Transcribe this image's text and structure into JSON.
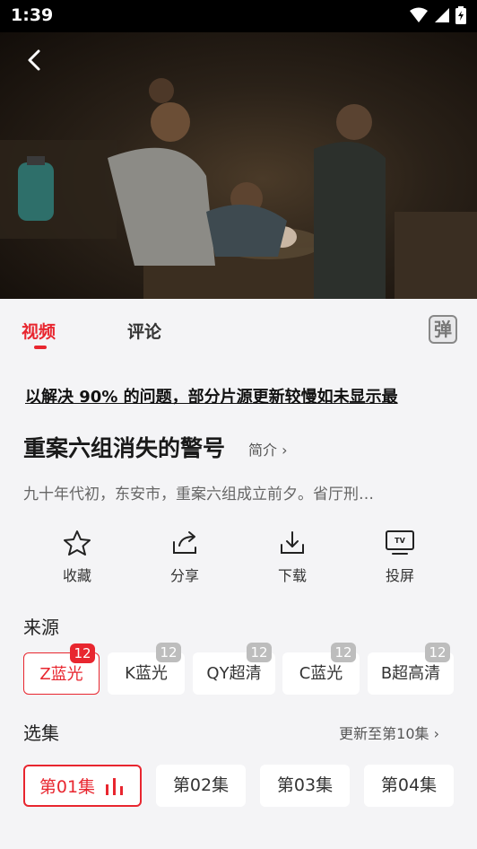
{
  "status_bar": {
    "time": "1:39"
  },
  "tabs": {
    "video": "视频",
    "comment": "评论",
    "danmaku": "弹"
  },
  "notice": "以解决 90% 的问题，部分片源更新较慢如未显示最",
  "show": {
    "title": "重案六组消失的警号",
    "intro_link": "简介 ›",
    "description": "九十年代初，东安市，重案六组成立前夕。省厅刑…"
  },
  "actions": [
    {
      "label": "收藏",
      "icon": "star-icon"
    },
    {
      "label": "分享",
      "icon": "share-icon"
    },
    {
      "label": "下载",
      "icon": "download-icon"
    },
    {
      "label": "投屏",
      "icon": "tv-cast-icon"
    }
  ],
  "sources": {
    "title": "来源",
    "items": [
      {
        "label": "Z蓝光",
        "badge": "12",
        "active": true
      },
      {
        "label": "K蓝光",
        "badge": "12",
        "active": false
      },
      {
        "label": "QY超清",
        "badge": "12",
        "active": false
      },
      {
        "label": "C蓝光",
        "badge": "12",
        "active": false
      },
      {
        "label": "B超高清",
        "badge": "12",
        "active": false
      }
    ]
  },
  "episodes": {
    "title": "选集",
    "update_link": "更新至第10集 ›",
    "items": [
      {
        "label": "第01集",
        "active": true
      },
      {
        "label": "第02集",
        "active": false
      },
      {
        "label": "第03集",
        "active": false
      },
      {
        "label": "第04集",
        "active": false
      }
    ]
  },
  "colors": {
    "accent": "#e8262f",
    "background": "#f4f4f6"
  }
}
